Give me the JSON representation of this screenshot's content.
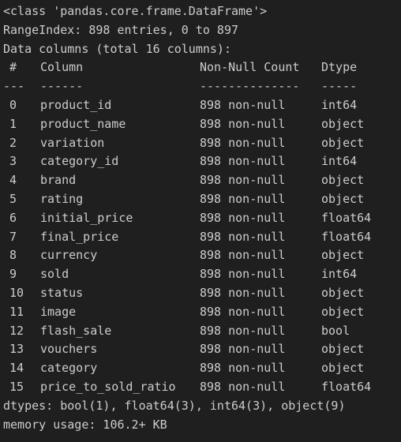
{
  "info": {
    "class_line": "<class 'pandas.core.frame.DataFrame'>",
    "range_index": "RangeIndex: 898 entries, 0 to 897",
    "data_columns": "Data columns (total 16 columns):",
    "header": {
      "idx": "#",
      "column": "Column",
      "non_null": "Non-Null Count",
      "dtype": "Dtype"
    },
    "separator": {
      "idx": "---",
      "column": "------",
      "non_null": "--------------",
      "dtype": "-----"
    },
    "rows": [
      {
        "idx": "0",
        "column": "product_id",
        "non_null": "898 non-null",
        "dtype": "int64"
      },
      {
        "idx": "1",
        "column": "product_name",
        "non_null": "898 non-null",
        "dtype": "object"
      },
      {
        "idx": "2",
        "column": "variation",
        "non_null": "898 non-null",
        "dtype": "object"
      },
      {
        "idx": "3",
        "column": "category_id",
        "non_null": "898 non-null",
        "dtype": "int64"
      },
      {
        "idx": "4",
        "column": "brand",
        "non_null": "898 non-null",
        "dtype": "object"
      },
      {
        "idx": "5",
        "column": "rating",
        "non_null": "898 non-null",
        "dtype": "object"
      },
      {
        "idx": "6",
        "column": "initial_price",
        "non_null": "898 non-null",
        "dtype": "float64"
      },
      {
        "idx": "7",
        "column": "final_price",
        "non_null": "898 non-null",
        "dtype": "float64"
      },
      {
        "idx": "8",
        "column": "currency",
        "non_null": "898 non-null",
        "dtype": "object"
      },
      {
        "idx": "9",
        "column": "sold",
        "non_null": "898 non-null",
        "dtype": "int64"
      },
      {
        "idx": "10",
        "column": "status",
        "non_null": "898 non-null",
        "dtype": "object"
      },
      {
        "idx": "11",
        "column": "image",
        "non_null": "898 non-null",
        "dtype": "object"
      },
      {
        "idx": "12",
        "column": "flash_sale",
        "non_null": "898 non-null",
        "dtype": "bool"
      },
      {
        "idx": "13",
        "column": "vouchers",
        "non_null": "898 non-null",
        "dtype": "object"
      },
      {
        "idx": "14",
        "column": "category",
        "non_null": "898 non-null",
        "dtype": "object"
      },
      {
        "idx": "15",
        "column": "price_to_sold_ratio",
        "non_null": "898 non-null",
        "dtype": "float64"
      }
    ],
    "dtypes_line": "dtypes: bool(1), float64(3), int64(3), object(9)",
    "memory_line": "memory usage: 106.2+ KB"
  }
}
